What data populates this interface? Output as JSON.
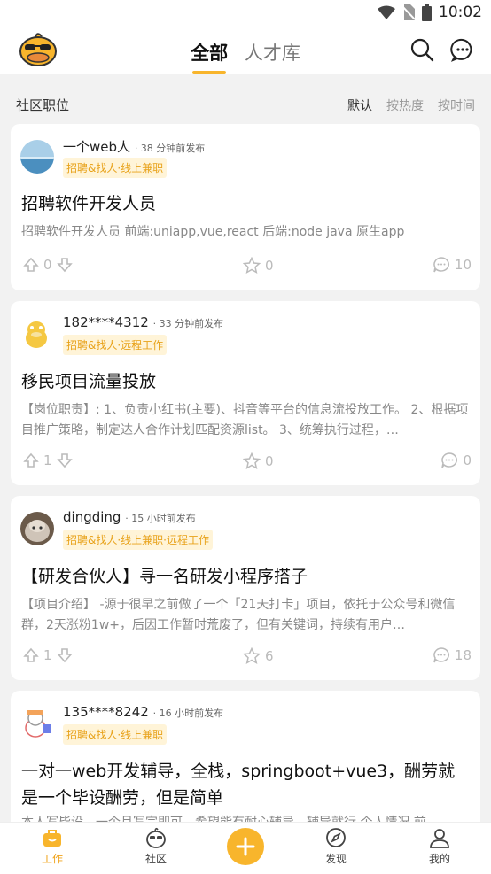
{
  "status": {
    "time": "10:02"
  },
  "header": {
    "tabs": [
      {
        "label": "全部"
      },
      {
        "label": "人才库"
      }
    ]
  },
  "filter": {
    "title": "社区职位",
    "sorts": [
      "默认",
      "按热度",
      "按时间"
    ]
  },
  "posts": [
    {
      "user": "一个web人",
      "time": "· 38 分钟前发布",
      "tag": "招聘&找人·线上兼职",
      "title": "招聘软件开发人员",
      "desc": "招聘软件开发人员 前端:uniapp,vue,react 后端:node java  原生app",
      "up": "0",
      "stars": "0",
      "comments": "10"
    },
    {
      "user": "182****4312",
      "time": "· 33 分钟前发布",
      "tag": "招聘&找人·远程工作",
      "title": "移民项目流量投放",
      "desc": "【岗位职责】: 1、负责小红书(主要)、抖音等平台的信息流投放工作。 2、根据项目推广策略，制定达人合作计划匹配资源list。 3、统筹执行过程，…",
      "up": "1",
      "stars": "0",
      "comments": "0"
    },
    {
      "user": "dingding",
      "time": "· 15 小时前发布",
      "tag": "招聘&找人·线上兼职·远程工作",
      "title": "【研发合伙人】寻一名研发小程序搭子",
      "desc": "【项目介绍】 -源于很早之前做了一个「21天打卡」项目，依托于公众号和微信群，2天涨粉1w+，后因工作暂时荒废了，但有关键词，持续有用户…",
      "up": "1",
      "stars": "6",
      "comments": "18"
    },
    {
      "user": "135****8242",
      "time": "· 16 小时前发布",
      "tag": "招聘&找人·线上兼职",
      "title": "一对一web开发辅导，全栈，springboot+vue3，酬劳就是一个毕设酬劳，但是简单",
      "desc": "本人写毕设，一个月写完即可，希望能有耐心辅导，辅导就行 个人情况 前",
      "up": "",
      "stars": "",
      "comments": ""
    }
  ],
  "bottom_nav": [
    {
      "label": "工作"
    },
    {
      "label": "社区"
    },
    {
      "label": "发现"
    },
    {
      "label": "我的"
    }
  ],
  "colors": {
    "accent": "#f8b52c",
    "tag_text": "#e8a21a",
    "tag_bg": "#fff4d8"
  }
}
